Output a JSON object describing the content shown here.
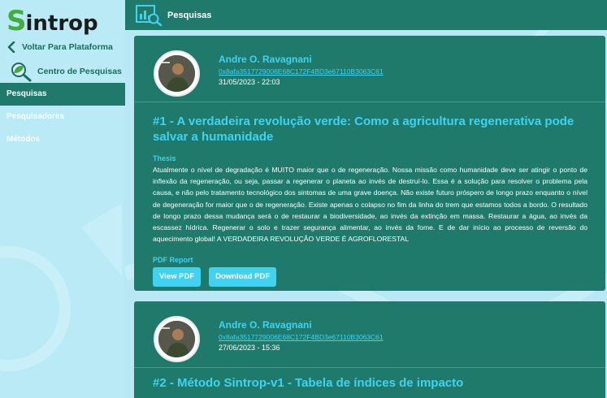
{
  "sidebar": {
    "logo_first": "S",
    "logo_rest": "introp",
    "back_label": "Voltar Para Plataforma",
    "centro_label": "Centro de Pesquisas",
    "items": [
      {
        "label": "Pesquisas",
        "active": true
      },
      {
        "label": "Pesquisadores",
        "active": false
      },
      {
        "label": "Métodos",
        "active": false
      }
    ]
  },
  "header": {
    "title": "Pesquisas"
  },
  "posts": [
    {
      "author": "Andre O. Ravagnani",
      "wallet": "0x8afa3517729006E68C172F4BD3e67110B3063C61",
      "date": "31/05/2023 - 22:03",
      "title": "#1 - A verdadeira revolução verde: Como a agricultura regenerativa pode salvar a humanidade",
      "thesis_label": "Thesis",
      "thesis": "Atualmente o nível de degradação é MUITO maior que o de regeneração. Nossa missão como humanidade deve ser atingir o ponto de inflexão da regeneração, ou seja, passar a regenerar o planeta ao invés de destruí-lo. Essa é a solução para resolver o problema pela causa, e não pelo tratamento tecnológico dos sintomas de uma grave doença. Não existe futuro próspero de longo prazo enquanto o nível de degeneração for maior que o de regeneração. Existe apenas o colapso no fim da linha do trem que estamos todos a bordo. O resultado de longo prazo dessa mudança será o de restaurar a biodiversidade, ao invés da extinção em massa. Restaurar a água, ao invés da escassez hídrica. Regenerar o solo e trazer segurança alimentar, ao invés da fome. E de dar início ao processo de reversão do aquecimento global! A VERDADEIRA REVOLUÇÃO VERDE É AGROFLORESTAL",
      "pdf_label": "PDF Report",
      "view_label": "View PDF",
      "download_label": "Download PDF"
    },
    {
      "author": "Andre O. Ravagnani",
      "wallet": "0x8afa3517729006E68C172F4BD3e67110B3063C61",
      "date": "27/06/2023 - 15:36",
      "title": "#2 - Método Sintrop-v1 - Tabela de índices de impacto"
    }
  ],
  "colors": {
    "accent": "#3fd3f1",
    "primary": "#1f7a6c",
    "sidebar_bg": "#b9eaf6",
    "logo_green": "#3fae3a"
  }
}
